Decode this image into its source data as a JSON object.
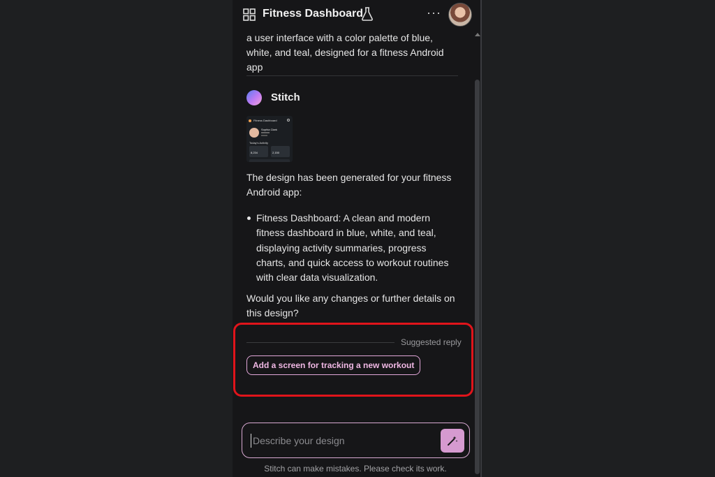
{
  "header": {
    "title": "Fitness Dashboard",
    "grid_icon": "grid-icon",
    "flask_icon": "flask-icon",
    "more_icon": "more-horizontal-icon",
    "more_glyph": "···"
  },
  "chat": {
    "user_message_tail": "a user interface with a color palette of blue, white, and teal, designed for a fitness Android app",
    "assistant_name": "Stitch",
    "thumbnail": {
      "title": "Fitness Dashboard",
      "name": "Sophia Clark",
      "section": "Today's Activity",
      "value1": "8,234",
      "value2": "2,150"
    },
    "intro": "The design has been generated for your fitness Android app:",
    "bullets": [
      "Fitness Dashboard: A clean and modern fitness dashboard in blue, white, and teal, displaying activity summaries, progress charts, and quick access to workout routines with clear data visualization."
    ],
    "question": "Would you like any changes or further details on this design?"
  },
  "suggested": {
    "label": "Suggested reply",
    "chip": "Add a screen for tracking a new workout"
  },
  "composer": {
    "placeholder": "Describe your design",
    "send_icon": "magic-wand-icon",
    "disclaimer": "Stitch can make mistakes. Please check its work."
  },
  "colors": {
    "background": "#1e1f21",
    "panel": "#161618",
    "accent": "#d69ad0",
    "highlight_border": "#e0141b"
  }
}
